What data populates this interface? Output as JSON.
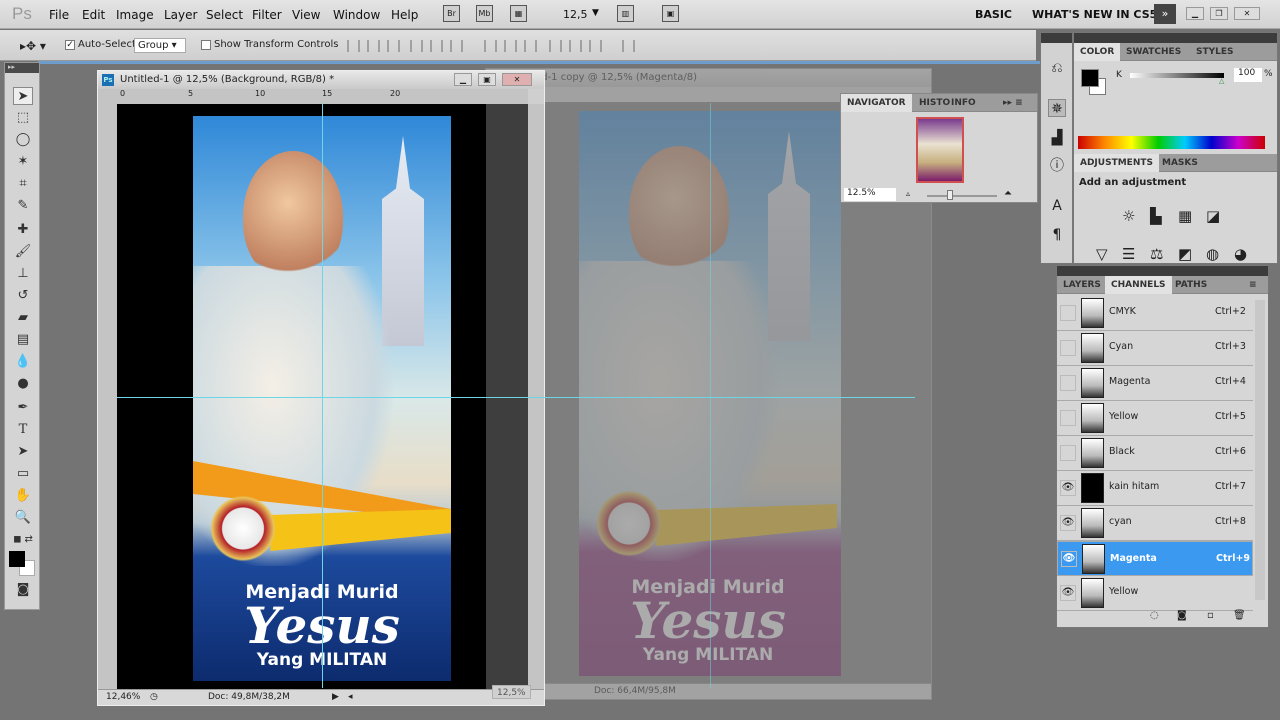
{
  "app": {
    "logo": "Ps"
  },
  "menu": [
    "File",
    "Edit",
    "Image",
    "Layer",
    "Select",
    "Filter",
    "View",
    "Window",
    "Help"
  ],
  "appbar": {
    "bridge": "Br",
    "minibridge": "Mb",
    "zoom": "12,5",
    "workspaces": [
      "BASIC",
      "WHAT'S NEW IN CS5"
    ]
  },
  "options": {
    "auto_select_label": "Auto-Select:",
    "auto_select_value": "Group",
    "show_transform": "Show Transform Controls",
    "auto_select_checked": true,
    "show_transform_checked": false
  },
  "doc1": {
    "title": "Untitled-1 @ 12,5% (Background, RGB/8) *",
    "zoom": "12,46%",
    "doc_size": "Doc: 49,8M/38,2M",
    "ruler_top": [
      "0",
      "5",
      "10",
      "15",
      "20"
    ],
    "poster": {
      "line1": "Menjadi Murid",
      "line2": "Yesus",
      "line3": "Yang MILITAN"
    }
  },
  "doc2": {
    "title": "Untitled-1 copy @ 12,5% (Magenta/8)",
    "zoom": "12,5%",
    "doc_size": "Doc: 66,4M/95,8M"
  },
  "navigator": {
    "tabs": [
      "NAVIGATOR",
      "HISTO",
      "INFO"
    ],
    "zoom": "12.5%"
  },
  "color": {
    "tabs": [
      "COLOR",
      "SWATCHES",
      "STYLES"
    ],
    "channel": "K",
    "value": "100",
    "unit": "%"
  },
  "adjustments": {
    "tabs": [
      "ADJUSTMENTS",
      "MASKS"
    ],
    "heading": "Add an adjustment"
  },
  "channels_panel": {
    "tabs": [
      "LAYERS",
      "CHANNELS",
      "PATHS"
    ],
    "rows": [
      {
        "name": "CMYK",
        "shortcut": "Ctrl+2",
        "visible": false
      },
      {
        "name": "Cyan",
        "shortcut": "Ctrl+3",
        "visible": false
      },
      {
        "name": "Magenta",
        "shortcut": "Ctrl+4",
        "visible": false
      },
      {
        "name": "Yellow",
        "shortcut": "Ctrl+5",
        "visible": false
      },
      {
        "name": "Black",
        "shortcut": "Ctrl+6",
        "visible": false
      },
      {
        "name": "kain hitam",
        "shortcut": "Ctrl+7",
        "visible": true
      },
      {
        "name": "cyan",
        "shortcut": "Ctrl+8",
        "visible": true
      },
      {
        "name": "Magenta",
        "shortcut": "Ctrl+9",
        "visible": true,
        "selected": true
      },
      {
        "name": "Yellow",
        "shortcut": "",
        "visible": true
      }
    ]
  },
  "colors": {
    "accent": "#3b99f0",
    "guide": "#6cd6e6"
  }
}
